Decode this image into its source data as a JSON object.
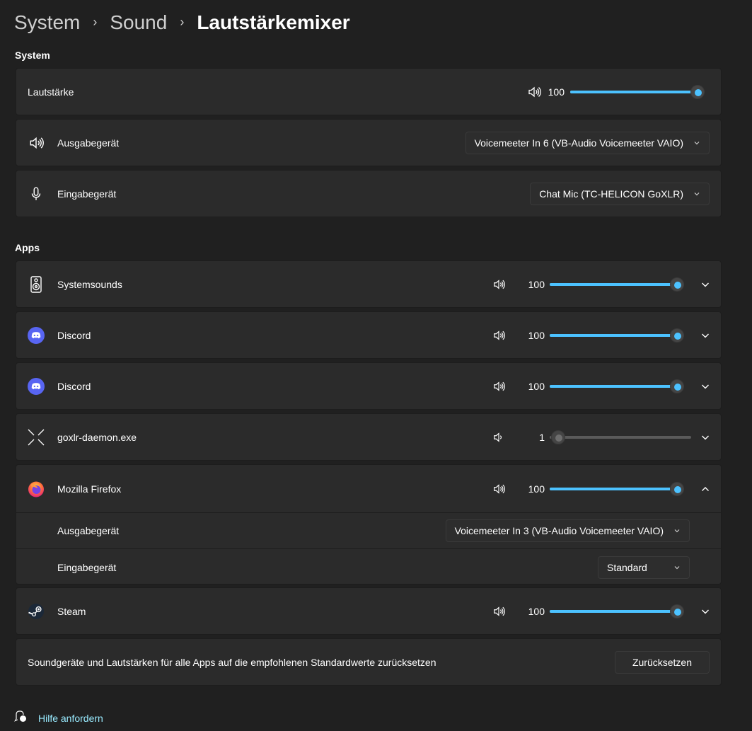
{
  "breadcrumb": {
    "items": [
      "System",
      "Sound",
      "Lautstärkemixer"
    ]
  },
  "system_section": {
    "title": "System",
    "volume": {
      "label": "Lautstärke",
      "value": "100",
      "level_percent": 100
    },
    "output": {
      "label": "Ausgabegerät",
      "selected": "Voicemeeter In 6 (VB-Audio Voicemeeter VAIO)",
      "icon": "speaker-icon"
    },
    "input": {
      "label": "Eingabegerät",
      "selected": "Chat Mic (TC-HELICON GoXLR)",
      "icon": "microphone-icon"
    }
  },
  "apps_section": {
    "title": "Apps",
    "apps": [
      {
        "name": "Systemsounds",
        "volume": "100",
        "level_percent": 100,
        "icon": "system-sounds-speaker-icon"
      },
      {
        "name": "Discord",
        "volume": "100",
        "level_percent": 100,
        "icon": "discord-icon"
      },
      {
        "name": "Discord",
        "volume": "100",
        "level_percent": 100,
        "icon": "discord-icon"
      },
      {
        "name": "goxlr-daemon.exe",
        "volume": "1",
        "level_percent": 1,
        "icon": "generic-app-icon"
      },
      {
        "name": "Mozilla Firefox",
        "volume": "100",
        "level_percent": 100,
        "icon": "firefox-icon",
        "expanded": true,
        "output_label": "Ausgabegerät",
        "output_selected": "Voicemeeter In 3 (VB-Audio Voicemeeter VAIO)",
        "input_label": "Eingabegerät",
        "input_selected": "Standard"
      },
      {
        "name": "Steam",
        "volume": "100",
        "level_percent": 100,
        "icon": "steam-icon"
      }
    ]
  },
  "reset": {
    "text": "Soundgeräte und Lautstärken für alle Apps auf die empfohlenen Standardwerte zurücksetzen",
    "button": "Zurücksetzen"
  },
  "help": {
    "label": "Hilfe anfordern"
  },
  "colors": {
    "accent": "#4cc2ff",
    "background": "#202020",
    "card": "#2b2b2b",
    "link": "#99ebff"
  }
}
